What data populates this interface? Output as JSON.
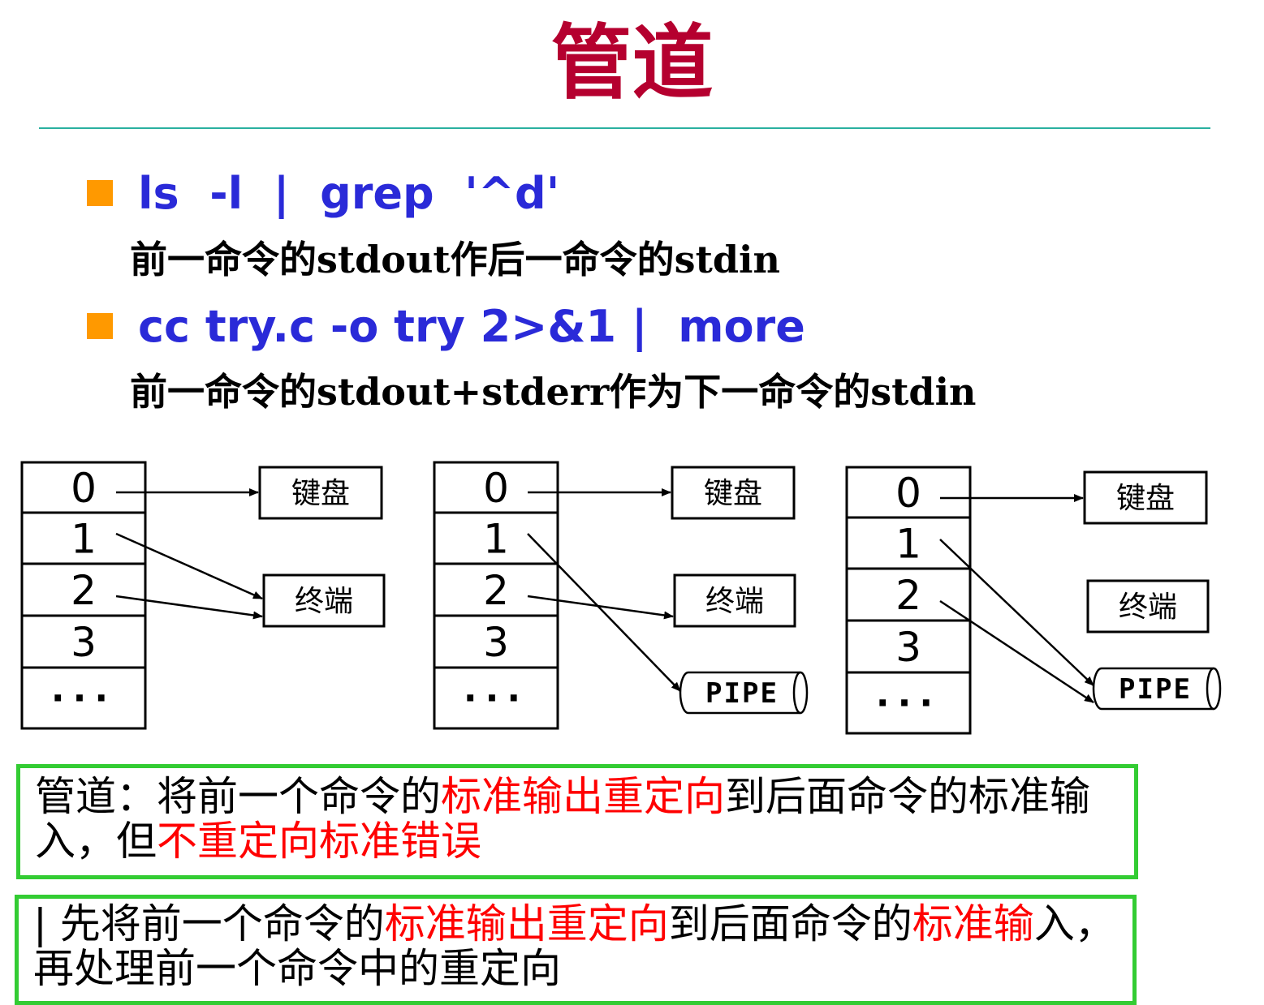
{
  "title": "管道",
  "bullets": [
    {
      "command": "ls  -l  |  grep  '^d'",
      "description": "前一命令的stdout作后一命令的stdin"
    },
    {
      "command": "cc try.c -o try 2>&1 |  more",
      "description": "前一命令的stdout+stderr作为下一命令的stdin"
    }
  ],
  "diagram": {
    "fd_labels": [
      "0",
      "1",
      "2",
      "3",
      "..."
    ],
    "keyboard_label": "键盘",
    "terminal_label": "终端",
    "pipe_label": "PIPE"
  },
  "note1": {
    "parts": [
      {
        "text": "管道：将前一个命令的",
        "red": false
      },
      {
        "text": "标准输出重定向",
        "red": true
      },
      {
        "text": "到后面命令的标准输入，但",
        "red": false
      },
      {
        "text": "不重定向标准错误",
        "red": true
      }
    ]
  },
  "note2": {
    "parts": [
      {
        "text": "| ",
        "red": false
      },
      {
        "text": "先将前一个命令的",
        "red": false
      },
      {
        "text": "标准输出重定向",
        "red": true
      },
      {
        "text": "到后面命令的",
        "red": false
      },
      {
        "text": "标准输",
        "red": true
      },
      {
        "text": "入，再处理前一个命令中的重定向",
        "red": false
      }
    ]
  },
  "colors": {
    "title": "#b5002f",
    "command": "#2a2ad8",
    "bullet": "#ff9900",
    "rule": "#2ab0a0",
    "box_border": "#33cc33",
    "highlight": "#ff0000"
  }
}
